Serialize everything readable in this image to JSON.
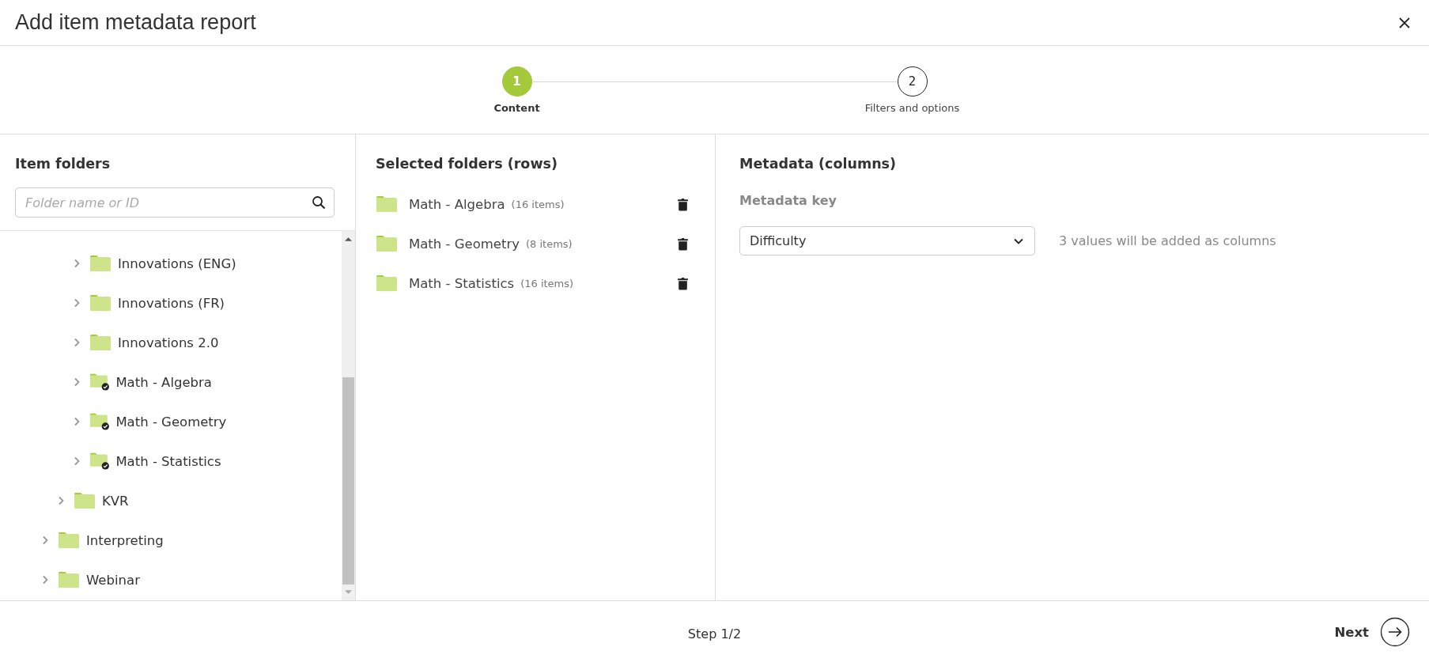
{
  "dialog": {
    "title": "Add item metadata report"
  },
  "steps": [
    {
      "number": "1",
      "label": "Content",
      "selected": true
    },
    {
      "number": "2",
      "label": "Filters and options",
      "selected": false
    }
  ],
  "item_folders": {
    "heading": "Item folders",
    "search": {
      "placeholder": "Folder name or ID"
    },
    "tree": [
      {
        "children": [
          {
            "children": [
              {
                "label": "Innovations (ENG)",
                "checked": false,
                "expanded": false
              },
              {
                "label": "Innovations (FR)",
                "checked": false,
                "expanded": false
              },
              {
                "label": "Innovations 2.0",
                "checked": false,
                "expanded": false
              },
              {
                "label": "Math - Algebra",
                "checked": true,
                "expanded": false
              },
              {
                "label": "Math - Geometry",
                "checked": true,
                "expanded": false
              },
              {
                "label": "Math - Statistics",
                "checked": true,
                "expanded": false
              }
            ]
          },
          {
            "label": "KVR",
            "checked": false,
            "expanded": false
          }
        ]
      },
      {
        "label": "Interpreting",
        "checked": false,
        "expanded": false
      },
      {
        "label": "Webinar",
        "checked": false,
        "expanded": false
      }
    ]
  },
  "selected_folders": {
    "heading": "Selected folders (rows)",
    "rows": [
      {
        "name": "Math - Algebra",
        "count": "(16 items)"
      },
      {
        "name": "Math - Geometry",
        "count": "(8 items)"
      },
      {
        "name": "Math - Statistics",
        "count": "(16 items)"
      }
    ]
  },
  "metadata": {
    "heading": "Metadata (columns)",
    "key_label": "Metadata key",
    "key_value": "Difficulty",
    "note": "3 values will be added as columns"
  },
  "footer": {
    "step": "Step 1/2",
    "next": "Next"
  }
}
